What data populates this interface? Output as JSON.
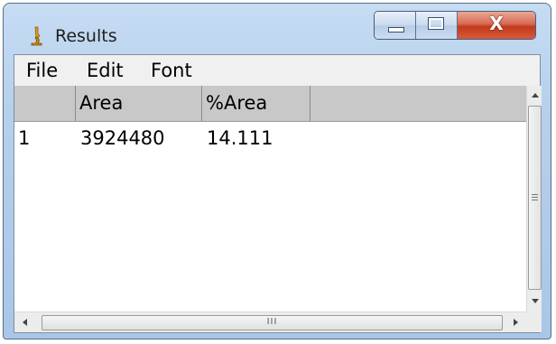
{
  "window": {
    "title": "Results",
    "icon": "imagej-microscope-icon",
    "caption_buttons": {
      "minimize": "",
      "maximize": "",
      "close": "X"
    }
  },
  "menubar": {
    "items": [
      "File",
      "Edit",
      "Font"
    ]
  },
  "table": {
    "columns": [
      "",
      "Area",
      "%Area"
    ],
    "rows": [
      {
        "index": "1",
        "area": "3924480",
        "percent_area": "14.111"
      }
    ]
  },
  "scrollbars": {
    "horizontal_grip": "III"
  },
  "colors": {
    "window_frame": "#b7d0ec",
    "close_button": "#c4391c",
    "header_bg": "#c8c8c8"
  }
}
